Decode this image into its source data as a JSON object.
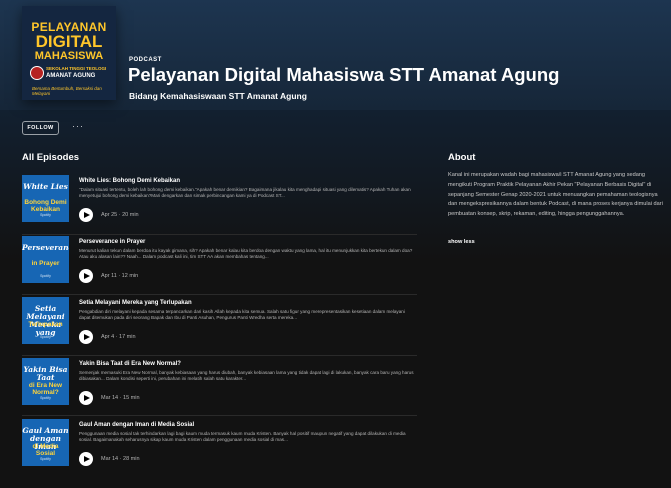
{
  "podcast": {
    "kind": "PODCAST",
    "title": "Pelayanan Digital Mahasiswa STT Amanat Agung",
    "publisher": "Bidang Kemahasiswaan STT Amanat Agung",
    "cover": {
      "line1": "PELAYANAN",
      "line2": "DIGITAL",
      "line3": "MAHASISWA",
      "school_small": "SEKOLAH TINGGI TEOLOGI",
      "school": "AMANAT AGUNG",
      "motto": "Bersama Bertumbuh, Bersaksi dan Melayani"
    }
  },
  "actions": {
    "follow_label": "FOLLOW",
    "more_label": "···"
  },
  "episodes_heading": "All Episodes",
  "episodes": [
    {
      "title": "White Lies: Bohong Demi Kebaikan",
      "description": "\"Dalam situasi tertentu, boleh lah bohong demi kebaikan.\"Apakah benar demikian? Bagaimana jikalau kita menghadapi situasi yang dilematis? Apakah Tuhan akan menyetujui bohong demi kebaikan?Mari dengarkan dan simak perbincangan kami ya di Podcast ST...",
      "meta": "Apr 25 · 20 min",
      "thumb": {
        "line1": "White Lies",
        "line2": "Bohong Demi Kebaikan",
        "line3": "Spotify"
      }
    },
    {
      "title": "Perseverance in Prayer",
      "description": "Menurut kalian tekun dalam berdoa itu kayak gimana, sih? Apakah benar kalau kita berdoa dengan waktu yang lama, hal itu menunjukkan kita bertekun dalam doa? Atau aku alasan lain?? Naah... Dalam podcast kali ini, tim STT AA akan membahas tentang...",
      "meta": "Apr 11 · 12 min",
      "thumb": {
        "line1": "Perseverance",
        "line2": "in Prayer",
        "line3": "Spotify"
      }
    },
    {
      "title": "Setia Melayani Mereka yang Terlupakan",
      "description": "Pengabdian diri melayani kepada sesama terpancarkan dari kasih Allah kepada kita semua. Salah satu figur yang merepresentasikan kesetiaan dalam melayani dapat ditemukan pada diri seorang Bapak dan Ibu di Panti Asuhan, Pengurus Panti Wredha serta mereka...",
      "meta": "Apr 4 · 17 min",
      "thumb": {
        "line1": "Setia Melayani Mereka yang",
        "line2": "Terlupakan",
        "line3": "Spotify"
      }
    },
    {
      "title": "Yakin Bisa Taat di Era New Normal?",
      "description": "Semenjak memasuki Era New Normal, banyak kebiasaan yang harus diubah, banyak kebiasaan lama yang tidak dapat lagi di lakukan, banyak cara baru yang harus dibiasakan... Dalam kondisi seperti ini, perubahan ini melatih salah satu karakter...",
      "meta": "Mar 14 · 15 min",
      "thumb": {
        "line1": "Yakin Bisa Taat",
        "line2": "di Era New Normal?",
        "line3": "Spotify"
      }
    },
    {
      "title": "Gaul Aman dengan Iman di Media Sosial",
      "description": "Penggunaan media sosial tak terhindarkan lagi bagi kaum muda termasuk kaum muda Kristen. Banyak hal positif maupun negatif yang dapat dilakukan di media sosial. Bagaimanakah seharusnya sikap kaum muda Kristen dalam penggunaan media sosial di mas...",
      "meta": "Mar 14 · 28 min",
      "thumb": {
        "line1": "Gaul Aman dengan Iman",
        "line2": "di Media Sosial",
        "line3": "Spotify"
      }
    }
  ],
  "about": {
    "heading": "About",
    "text": "Kanal ini merupakan wadah bagi mahasiswa/i STT Amanat Agung yang sedang mengikuti Program Praktik Pelayanan Akhir Pekan \"Pelayanan Berbasis Digital\" di sepanjang Semester Genap 2020-2021 untuk menuangkan pemahaman teologisnya dan mengekspresikannya dalam bentuk Podcast, di mana proses kerjanya dimulai dari pembuatan konsep, skrip, rekaman, editing, hingga pengunggahannya.",
    "show_less": "show less"
  },
  "colors": {
    "background": "#121212",
    "hero": "#1d3550",
    "accent_thumb": "#1766b4",
    "cover_text": "#ffc62a"
  }
}
